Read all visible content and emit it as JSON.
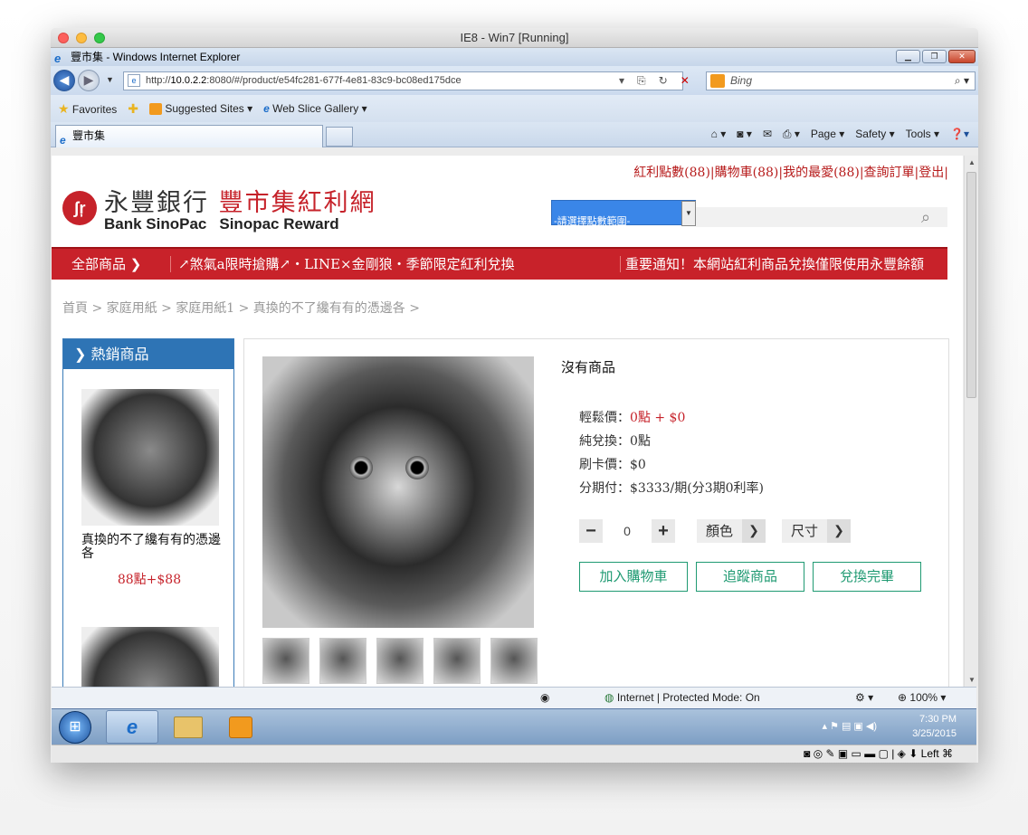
{
  "mac": {
    "title": "IE8 - Win7 [Running]"
  },
  "ie": {
    "window_title": "豐市集 - Windows Internet Explorer",
    "url_prefix": "http://",
    "url_host": "10.0.2.2",
    "url_rest": ":8080/#/product/e54fc281-677f-4e81-83c9-bc08ed175dce",
    "search_placeholder": "Bing",
    "favorites": "Favorites",
    "suggested_sites": "Suggested Sites ▾",
    "web_slice": "Web Slice Gallery ▾",
    "tab_title": "豐市集",
    "cmd": {
      "page": "Page ▾",
      "safety": "Safety ▾",
      "tools": "Tools ▾"
    }
  },
  "site": {
    "toplinks": "紅利點數(88)|購物車(88)|我的最愛(88)|查詢訂單|登出|",
    "logo_cn_1": "永豐銀行",
    "logo_cn_2": "豐市集紅利網",
    "logo_en_1": "Bank SinoPac",
    "logo_en_2": "Sinopac Reward",
    "search_select": "-請選擇點數範圍-",
    "nav_all": "全部商品 ❯",
    "nav_promo": "↗煞氣a限時搶購↗・LINE×金剛狼・季節限定紅利兌換",
    "nav_notice": "重要通知！本網站紅利商品兌換僅限使用永豐餘額",
    "breadcrumb": "首頁 > 家庭用紙 > 家庭用紙1 > 真換的不了纔有有的憑邊各 >",
    "hot_title": "熱銷商品",
    "hot_items": [
      {
        "name": "真換的不了纔有有的憑邊各",
        "price": "88點+$88"
      }
    ],
    "product": {
      "title": "沒有商品",
      "easy_price_label": "輕鬆價：",
      "easy_price_value": "0點 + $0",
      "pure_label": "純兌換：0點",
      "card_label": "刷卡價：$0",
      "install_label": "分期付：$3333/期(分3期0利率)",
      "qty": "0",
      "color": "顏色",
      "size": "尺寸",
      "add_cart": "加入購物車",
      "track": "追蹤商品",
      "redeem": "兌換完畢"
    }
  },
  "status": {
    "zone": "Internet | Protected Mode: On",
    "zoom": "100%"
  },
  "taskbar": {
    "time": "7:30 PM",
    "date": "3/25/2015"
  },
  "vbox": {
    "host_key": "Left ⌘"
  }
}
